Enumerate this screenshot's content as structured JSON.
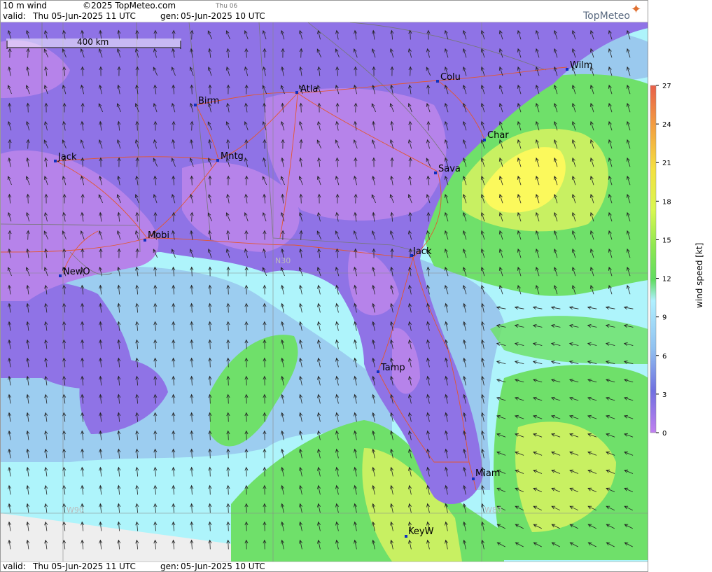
{
  "header": {
    "title": "10 m wind",
    "copyright": "©2025 TopMeteo.com",
    "day_tab": "Thu 06",
    "valid_label": "valid:",
    "valid_value": "Thu  05-Jun-2025  11 UTC",
    "gen_label": "gen:",
    "gen_value": "05-Jun-2025 10 UTC"
  },
  "footer": {
    "valid_label": "valid:",
    "valid_value": "Thu  05-Jun-2025  11 UTC",
    "gen_label": "gen:",
    "gen_value": "05-Jun-2025 10 UTC"
  },
  "logo_text": "TopMeteo",
  "scale_bar": "400 km",
  "grid_labels": {
    "lat": "N30",
    "lon_west": "W90",
    "lon_east": "W80"
  },
  "cities": [
    {
      "name": "Atla"
    },
    {
      "name": "Birm"
    },
    {
      "name": "Colu"
    },
    {
      "name": "Wilm"
    },
    {
      "name": "Char"
    },
    {
      "name": "Sava"
    },
    {
      "name": "Jack"
    },
    {
      "name": "Mntg"
    },
    {
      "name": "Mobi"
    },
    {
      "name": "NewO"
    },
    {
      "name": "Jack"
    },
    {
      "name": "Tamp"
    },
    {
      "name": "Miam"
    },
    {
      "name": "KeyW"
    }
  ],
  "colorbar": {
    "title": "wind speed [kt]",
    "unit": "kt",
    "ticks": [
      "27",
      "24",
      "21",
      "18",
      "15",
      "12",
      "9",
      "6",
      "3",
      "0"
    ],
    "colors": [
      "#e8604a",
      "#f3a040",
      "#f4e040",
      "#ffff50",
      "#c8f050",
      "#90e850",
      "#50d860",
      "#b0f0ff",
      "#90c0f0",
      "#7070e0",
      "#9a66e8",
      "#c080f0"
    ]
  },
  "colors": {
    "calm": "#b683ea",
    "light": "#8f73e6",
    "moderate_blue": "#9ac9ee",
    "sea_cyan": "#aef4fb",
    "green": "#6fe06a",
    "yellow_green": "#c8f062",
    "yellow": "#fbf95c",
    "nodata": "#eeeeee",
    "roads": "#e4572e",
    "borders": "#777777"
  }
}
